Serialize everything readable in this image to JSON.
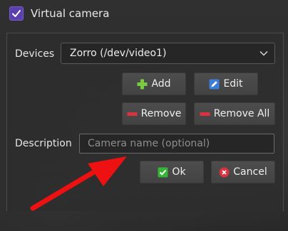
{
  "virtual_camera": {
    "label": "Virtual camera",
    "checked": true
  },
  "devices": {
    "label": "Devices",
    "selected": "Zorro (/dev/video1)"
  },
  "buttons": {
    "add": "Add",
    "edit": "Edit",
    "remove": "Remove",
    "remove_all": "Remove All",
    "ok": "Ok",
    "cancel": "Cancel"
  },
  "description": {
    "label": "Description",
    "value": "",
    "placeholder": "Camera name (optional)"
  },
  "icons": {
    "checkbox": "checkmark-icon",
    "dropdown": "chevron-down-icon",
    "add": "plus-icon",
    "edit": "pencil-icon",
    "remove": "minus-icon",
    "remove_all": "minus-icon",
    "ok": "check-icon",
    "cancel": "cancel-icon",
    "annotation": "red-arrow-icon"
  },
  "colors": {
    "checkbox": "#5b3fb0",
    "add_icon": "#7ac943",
    "edit_icon": "#3b7dd8",
    "remove_icon": "#d9333f",
    "ok_icon": "#35b535",
    "cancel_icon": "#d9333f",
    "annotation_arrow": "#ee1111"
  }
}
